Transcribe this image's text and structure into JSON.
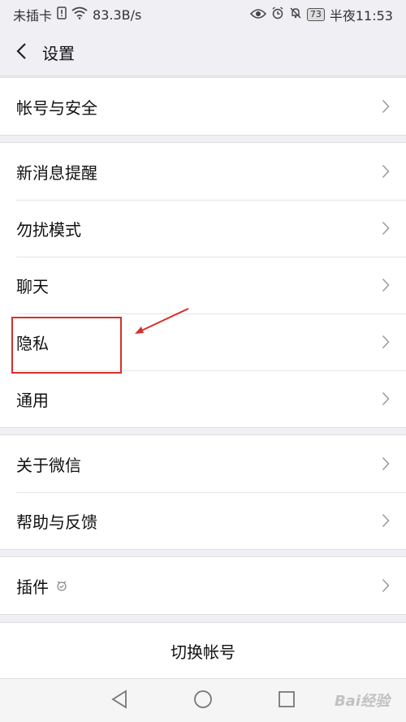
{
  "status_bar": {
    "carrier": "未插卡",
    "speed": "83.3B/s",
    "battery": "73",
    "time": "半夜11:53"
  },
  "header": {
    "title": "设置"
  },
  "groups": [
    {
      "items": [
        {
          "label": "帐号与安全"
        }
      ]
    },
    {
      "items": [
        {
          "label": "新消息提醒"
        },
        {
          "label": "勿扰模式"
        },
        {
          "label": "聊天"
        },
        {
          "label": "隐私"
        },
        {
          "label": "通用"
        }
      ]
    },
    {
      "items": [
        {
          "label": "关于微信"
        },
        {
          "label": "帮助与反馈"
        }
      ]
    },
    {
      "items": [
        {
          "label": "插件"
        }
      ]
    }
  ],
  "switch_account": "切换帐号",
  "watermark": "Bai经验",
  "colors": {
    "background": "#efeff4",
    "card": "#ffffff",
    "annotation": "#d6302a"
  }
}
